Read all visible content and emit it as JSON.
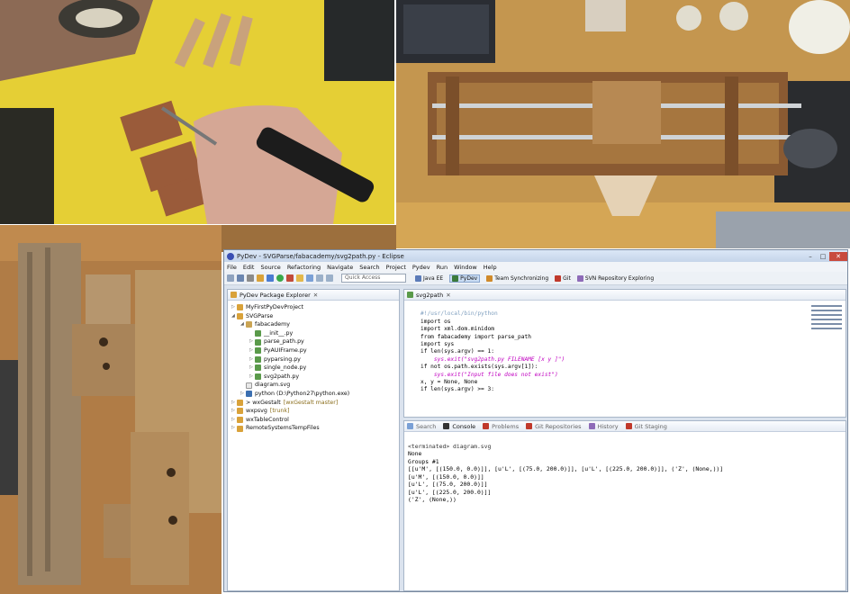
{
  "window": {
    "title": "PyDev - SVGParse/fabacademy/svg2path.py - Eclipse",
    "buttons": [
      "–",
      "□",
      "✕"
    ]
  },
  "menu": [
    "File",
    "Edit",
    "Source",
    "Refactoring",
    "Navigate",
    "Search",
    "Project",
    "Pydev",
    "Run",
    "Window",
    "Help"
  ],
  "toolbar": {
    "quick_access": "Quick Access",
    "perspectives": [
      "Java EE",
      "PyDev",
      "Team Synchronizing",
      "Git",
      "SVN Repository Exploring"
    ]
  },
  "explorer": {
    "tab": "PyDev Package Explorer",
    "items": [
      {
        "label": "MyFirstPyDevProject",
        "decoration": ""
      },
      {
        "label": "SVGParse",
        "decoration": ""
      },
      {
        "label": "fabacademy",
        "decoration": ""
      },
      {
        "label": "__init__.py",
        "decoration": ""
      },
      {
        "label": "parse_path.py",
        "decoration": ""
      },
      {
        "label": "PyAUIFrame.py",
        "decoration": ""
      },
      {
        "label": "pyparsing.py",
        "decoration": ""
      },
      {
        "label": "single_node.py",
        "decoration": ""
      },
      {
        "label": "svg2path.py",
        "decoration": ""
      },
      {
        "label": "diagram.svg",
        "decoration": ""
      },
      {
        "label": "python  (D:\\Python27\\python.exe)",
        "decoration": ""
      },
      {
        "label": "> wxGestalt",
        "decoration": "[wxGestalt master]"
      },
      {
        "label": "wxpsvg",
        "decoration": "[trunk]"
      },
      {
        "label": "wxTableControl",
        "decoration": ""
      },
      {
        "label": "RemoteSystemsTempFiles",
        "decoration": ""
      }
    ]
  },
  "editor": {
    "tab": "svg2path",
    "lines": [
      "#!/usr/local/bin/python",
      "",
      "import os",
      "import xml.dom.minidom",
      "from fabacademy import parse_path",
      "import sys",
      "",
      "",
      "if len(sys.argv) == 1:",
      "    sys.exit(\"svg2path.py FILENAME [x y ]\")",
      "if not os.path.exists(sys.argv[1]):",
      "    sys.exit(\"Input file does not exist\")",
      "x, y = None, None",
      "if len(sys.argv) >= 3:"
    ]
  },
  "console": {
    "tabs": [
      "Search",
      "Console",
      "Problems",
      "Git Repositories",
      "History",
      "Git Staging"
    ],
    "active_tab": "Console",
    "status": "<terminated> diagram.svg",
    "lines": [
      "None",
      "Groups #1",
      "[[u'M', [(150.0, 0.0)]], [u'L', [(75.0, 200.0)]], [u'L', [(225.0, 200.0)]], ('Z', (None,))]",
      "[u'M', [(150.0, 0.0)]]",
      "[u'L', [(75.0, 200.0)]]",
      "[u'L', [(225.0, 200.0)]]",
      "('Z', (None,))"
    ]
  }
}
